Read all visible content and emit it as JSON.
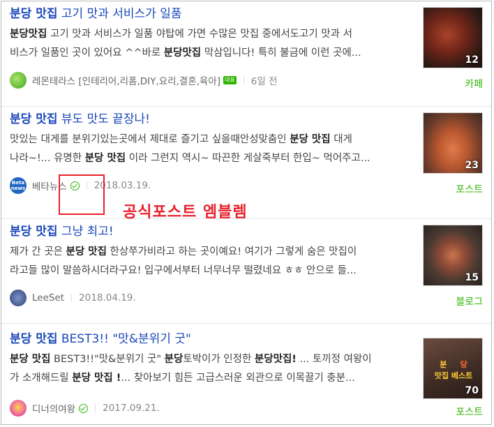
{
  "results": [
    {
      "title_bold": "분당 맛집",
      "title_rest": " 고기 맛과 서비스가 일품",
      "desc_lines": [
        [
          {
            "b": "분당맛집"
          },
          {
            "t": " 고기 맛과 서비스가 일품 야탑에 가면 수많은 맛집 중에서도고기 맛과 서"
          }
        ],
        [
          {
            "t": "비스가 일품인 곳이 있어요 ^^바로 "
          },
          {
            "b": "분당맛집"
          },
          {
            "t": " 막삼입니다! 특히 불금에 이런 곳에..."
          }
        ]
      ],
      "author": "레몬테라스 [인테리어,리폼,DIY,요리,결혼,육아]",
      "badge": "대표",
      "date": "6일 전",
      "source": "카페",
      "count": "12"
    },
    {
      "title_bold": "분당 맛집",
      "title_rest": " 뷰도 맛도 끝장나!",
      "desc_lines": [
        [
          {
            "t": "맛있는 대게를 분위기있는곳에서 제대로 즐기고 싶을때안성맞춤인 "
          },
          {
            "b": "분당 맛집"
          },
          {
            "t": " 대게"
          }
        ],
        [
          {
            "t": "나라~!... 유명한 "
          },
          {
            "b": "분당 맛집"
          },
          {
            "t": " 이라 그런지 역시~ 따끈한 게살죽부터 한입~ 먹어주고..."
          }
        ]
      ],
      "author": "베타뉴스",
      "date": "2018.03.19.",
      "source": "포스트",
      "count": "23"
    },
    {
      "title_bold": "분당 맛집",
      "title_rest": " 그냥 최고!",
      "desc_lines": [
        [
          {
            "t": "제가 간 곳은 "
          },
          {
            "b": "분당 맛집"
          },
          {
            "t": " 한상쭈가비라고 하는 곳이예요! 여기가 그렇게 숨은 맛집이"
          }
        ],
        [
          {
            "t": "라고들 많이 말씀하시더라구요! 입구에서부터 너무너무 떨렸네요 ㅎㅎ 안으로 들..."
          }
        ]
      ],
      "author": "LeeSet",
      "date": "2018.04.19.",
      "source": "블로그",
      "count": "15"
    },
    {
      "title_bold": "분당 맛집",
      "title_rest": " BEST3!! \"맛&분위기 굿\"",
      "desc_lines": [
        [
          {
            "b": "분당 맛집"
          },
          {
            "t": " BEST3!!\"맛&분위기 굿\" "
          },
          {
            "b": "분당"
          },
          {
            "t": "토박이가 인정한 "
          },
          {
            "b": "분당맛집!"
          },
          {
            "t": " ... 토끼정 여왕이"
          }
        ],
        [
          {
            "t": "가 소개해드릴 "
          },
          {
            "b": "분당 맛집 !"
          },
          {
            "t": "... 찾아보기 힘든 고급스러운 외관으로 이목끌기 충분..."
          }
        ]
      ],
      "author": "디너의여왕",
      "date": "2017.09.21.",
      "source": "포스트",
      "count": "70",
      "thumb_text": [
        "분",
        "당",
        "맛집 베스트"
      ]
    }
  ],
  "beta_logo": [
    "Beta",
    "news"
  ],
  "annotation": "공식포스트 엠블렘",
  "colors": {
    "title": "#1a47b8",
    "source": "#2db400",
    "callout": "#e8212b"
  }
}
